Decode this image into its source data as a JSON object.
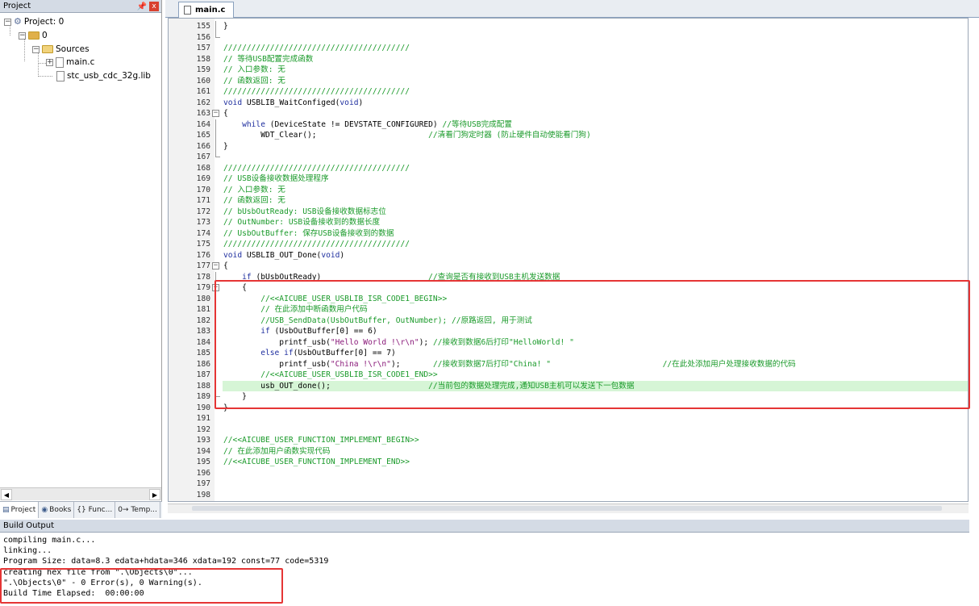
{
  "project_panel": {
    "title": "Project",
    "pin_glyph": "⌘",
    "close_glyph": "x",
    "tree": {
      "root": "Project: 0",
      "target": "0",
      "group": "Sources",
      "files": [
        "main.c",
        "stc_usb_cdc_32g.lib"
      ]
    },
    "tabs": [
      "Project",
      "Books",
      "{} Func...",
      "0→ Temp..."
    ]
  },
  "editor": {
    "tab_label": "main.c",
    "lines": [
      {
        "n": "155",
        "text": "}",
        "cls": "c-plain",
        "fold": "vline"
      },
      {
        "n": "156",
        "text": "",
        "cls": "c-plain",
        "fold": "end"
      },
      {
        "n": "157",
        "text": "////////////////////////////////////////",
        "cls": "c-comment",
        "fold": ""
      },
      {
        "n": "158",
        "text": "// 等待USB配置完成函数",
        "cls": "c-comment",
        "fold": ""
      },
      {
        "n": "159",
        "text": "// 入口参数: 无",
        "cls": "c-comment",
        "fold": ""
      },
      {
        "n": "160",
        "text": "// 函数返回: 无",
        "cls": "c-comment",
        "fold": ""
      },
      {
        "n": "161",
        "text": "////////////////////////////////////////",
        "cls": "c-comment",
        "fold": ""
      },
      {
        "n": "162",
        "text": "void USBLIB_WaitConfiged(void)",
        "cls": "c-plain",
        "fold": ""
      },
      {
        "n": "163",
        "text": "{",
        "cls": "c-plain",
        "fold": "box"
      },
      {
        "n": "164",
        "text": "    while (DeviceState != DEVSTATE_CONFIGURED) //等待USB完成配置",
        "cls": "mixed-while",
        "fold": "vline"
      },
      {
        "n": "165",
        "text": "        WDT_Clear();                        //清看门狗定时器 (防止硬件自动使能看门狗)",
        "cls": "mixed-wdt",
        "fold": "vline"
      },
      {
        "n": "166",
        "text": "}",
        "cls": "c-plain",
        "fold": "vline"
      },
      {
        "n": "167",
        "text": "",
        "cls": "c-plain",
        "fold": "end"
      },
      {
        "n": "168",
        "text": "////////////////////////////////////////",
        "cls": "c-comment",
        "fold": ""
      },
      {
        "n": "169",
        "text": "// USB设备接收数据处理程序",
        "cls": "c-comment",
        "fold": ""
      },
      {
        "n": "170",
        "text": "// 入口参数: 无",
        "cls": "c-comment",
        "fold": ""
      },
      {
        "n": "171",
        "text": "// 函数返回: 无",
        "cls": "c-comment",
        "fold": ""
      },
      {
        "n": "172",
        "text": "// bUsbOutReady: USB设备接收数据标志位",
        "cls": "c-comment",
        "fold": ""
      },
      {
        "n": "173",
        "text": "// OutNumber: USB设备接收到的数据长度",
        "cls": "c-comment",
        "fold": ""
      },
      {
        "n": "174",
        "text": "// UsbOutBuffer: 保存USB设备接收到的数据",
        "cls": "c-comment",
        "fold": ""
      },
      {
        "n": "175",
        "text": "////////////////////////////////////////",
        "cls": "c-comment",
        "fold": ""
      },
      {
        "n": "176",
        "text": "void USBLIB_OUT_Done(void)",
        "cls": "c-plain",
        "fold": ""
      },
      {
        "n": "177",
        "text": "{",
        "cls": "c-plain",
        "fold": "box"
      },
      {
        "n": "178",
        "text": "    if (bUsbOutReady)                       //查询是否有接收到USB主机发送数据",
        "cls": "mixed-if",
        "fold": "vline"
      },
      {
        "n": "179",
        "text": "    {",
        "cls": "c-plain",
        "fold": "box"
      },
      {
        "n": "180",
        "text": "        //<<AICUBE_USER_USBLIB_ISR_CODE1_BEGIN>>",
        "cls": "c-comment",
        "fold": "vline"
      },
      {
        "n": "181",
        "text": "        // 在此添加中断函数用户代码",
        "cls": "c-comment",
        "fold": "vline"
      },
      {
        "n": "182",
        "text": "        //USB_SendData(UsbOutBuffer, OutNumber); //原路返回, 用于测试",
        "cls": "c-comment",
        "fold": "vline"
      },
      {
        "n": "183",
        "text": "        if (UsbOutBuffer[0] == 6)",
        "cls": "mixed-if2",
        "fold": "vline"
      },
      {
        "n": "184",
        "text": "            printf_usb(\"Hello World !\\r\\n\"); //接收到数据6后打印\"HelloWorld! \"",
        "cls": "mixed-printf1",
        "fold": "vline"
      },
      {
        "n": "185",
        "text": "        else if(UsbOutBuffer[0] == 7)",
        "cls": "mixed-elseif",
        "fold": "vline"
      },
      {
        "n": "186",
        "text": "            printf_usb(\"China !\\r\\n\");       //接收到数据7后打印\"China! \"                        //在此处添加用户处理接收数据的代码",
        "cls": "mixed-printf2",
        "fold": "vline"
      },
      {
        "n": "187",
        "text": "        //<<AICUBE_USER_USBLIB_ISR_CODE1_END>>",
        "cls": "c-comment",
        "fold": "vline"
      },
      {
        "n": "188",
        "text": "        usb_OUT_done();                     //当前包的数据处理完成,通知USB主机可以发送下一包数据",
        "cls": "mixed-done",
        "fold": "vline"
      },
      {
        "n": "189",
        "text": "    }",
        "cls": "c-plain",
        "fold": "end"
      },
      {
        "n": "190",
        "text": "}",
        "cls": "c-plain",
        "fold": "end"
      },
      {
        "n": "191",
        "text": "",
        "cls": "c-plain",
        "fold": ""
      },
      {
        "n": "192",
        "text": "",
        "cls": "c-plain",
        "fold": ""
      },
      {
        "n": "193",
        "text": "//<<AICUBE_USER_FUNCTION_IMPLEMENT_BEGIN>>",
        "cls": "c-comment",
        "fold": ""
      },
      {
        "n": "194",
        "text": "// 在此添加用户函数实现代码",
        "cls": "c-comment",
        "fold": ""
      },
      {
        "n": "195",
        "text": "//<<AICUBE_USER_FUNCTION_IMPLEMENT_END>>",
        "cls": "c-comment",
        "fold": ""
      },
      {
        "n": "196",
        "text": "",
        "cls": "c-plain",
        "fold": ""
      },
      {
        "n": "197",
        "text": "",
        "cls": "c-plain",
        "fold": ""
      },
      {
        "n": "198",
        "text": "",
        "cls": "c-plain",
        "fold": ""
      }
    ],
    "highlighted_line": "188"
  },
  "build_output": {
    "title": "Build Output",
    "lines": [
      "compiling main.c...",
      "linking...",
      "Program Size: data=8.3 edata+hdata=346 xdata=192 const=77 code=5319",
      "creating hex file from \".\\Objects\\0\"...",
      "\".\\Objects\\0\" - 0 Error(s), 0 Warning(s).",
      "Build Time Elapsed:  00:00:00"
    ]
  },
  "colors": {
    "comment": "#1a9a2a",
    "keyword": "#1f2f9f",
    "string": "#8a1a7a",
    "highlight": "#d6f5d6",
    "annotation_box": "#e53535"
  }
}
